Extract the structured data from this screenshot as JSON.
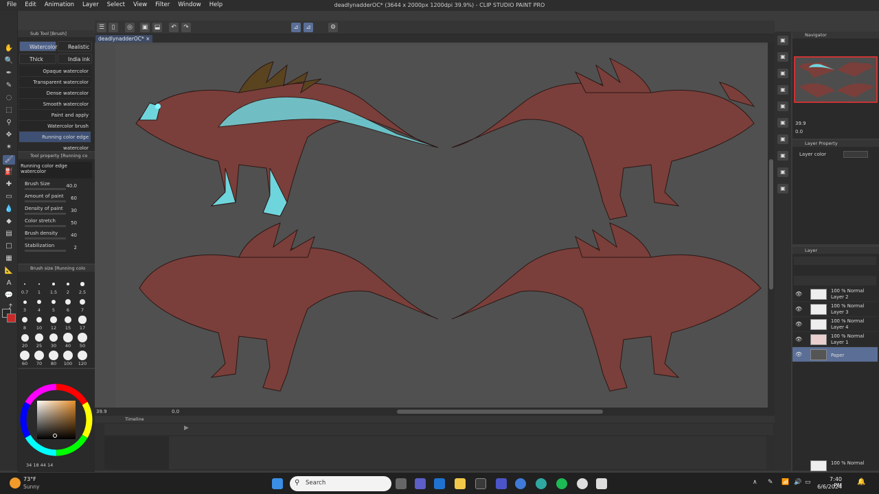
{
  "titlebar": {
    "menu": [
      "File",
      "Edit",
      "Animation",
      "Layer",
      "Select",
      "View",
      "Filter",
      "Window",
      "Help"
    ],
    "title": "deadlynadderOC* (3644 x 2000px 1200dpi 39.9%) - CLIP STUDIO PAINT PRO"
  },
  "canvas": {
    "tab_label": "deadlynadderOC*",
    "zoom_field": "39.9",
    "angle_field": "0.0"
  },
  "subtool": {
    "header": "Sub Tool [Brush]",
    "tabs": [
      "Watercolor",
      "Realistic",
      "Thick paint",
      "India ink"
    ],
    "brushes": [
      "Opaque watercolor",
      "Transparent watercolor",
      "Dense watercolor",
      "Smooth watercolor",
      "Paint and apply",
      "Watercolor brush",
      "Running color edge watercolor"
    ]
  },
  "toolprop": {
    "header": "Tool property [Running co",
    "name": "Running color edge watercolor",
    "props": [
      {
        "label": "Brush Size",
        "value": "40.0"
      },
      {
        "label": "Amount of paint",
        "value": "60"
      },
      {
        "label": "Density of paint",
        "value": "30"
      },
      {
        "label": "Color stretch",
        "value": "50"
      },
      {
        "label": "Brush density",
        "value": "40"
      },
      {
        "label": "Stabilization",
        "value": "2"
      }
    ]
  },
  "brushsize": {
    "header": "Brush size [Running colo",
    "rows": [
      [
        "0.7",
        "1",
        "1.5",
        "2",
        "2.5"
      ],
      [
        "3",
        "4",
        "5",
        "6",
        "7"
      ],
      [
        "8",
        "10",
        "12",
        "15",
        "17"
      ],
      [
        "20",
        "25",
        "30",
        "40",
        "50"
      ],
      [
        "60",
        "70",
        "80",
        "100",
        "120"
      ]
    ]
  },
  "colorpanel": {
    "readout": "34  18  44  14"
  },
  "navigator": {
    "header": "Navigator",
    "zoom": "39.9",
    "angle": "0.0"
  },
  "layerprop": {
    "header": "Layer Property",
    "layer_color_label": "Layer color"
  },
  "layers": {
    "header": "Layer",
    "items": [
      {
        "mode": "100 % Normal",
        "name": "Layer 2"
      },
      {
        "mode": "100 % Normal",
        "name": "Layer 3"
      },
      {
        "mode": "100 % Normal",
        "name": "Layer 4"
      },
      {
        "mode": "100 % Normal",
        "name": "Layer 1"
      },
      {
        "mode": "",
        "name": "Paper"
      }
    ],
    "bottom_mode": "100 % Normal"
  },
  "timeline": {
    "header": "Timeline"
  },
  "taskbar": {
    "weather_temp": "73°F",
    "weather_desc": "Sunny",
    "search_placeholder": "Search",
    "time": "7:40 PM",
    "date": "6/6/2024"
  },
  "colors": {
    "accent": "#4c5f86",
    "dragon_body": "#7a3f3a",
    "dragon_teal": "#6fd5dc",
    "canvas_bg": "#505050"
  }
}
